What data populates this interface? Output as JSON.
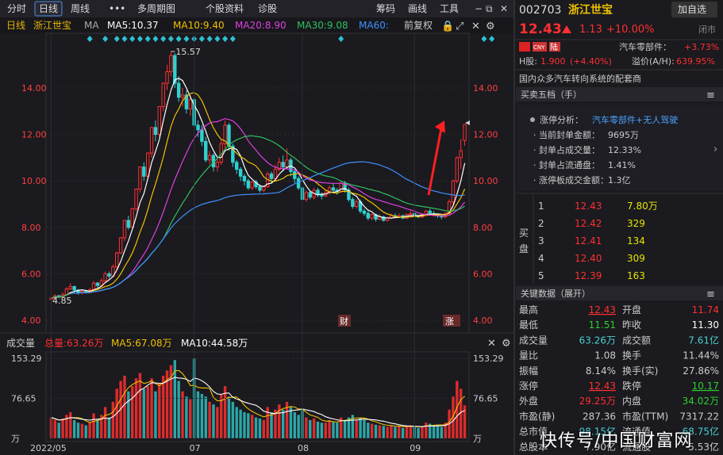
{
  "toolbar": {
    "tabs": [
      "分时",
      "日线",
      "周线",
      "•••",
      "多周期图",
      "个股资料",
      "诊股"
    ],
    "right": [
      "筹码",
      "画线",
      "工具"
    ],
    "colors": {
      "accent": "#4a90e2"
    }
  },
  "stock": {
    "code": "002703",
    "name": "浙江世宝",
    "add_label": "加自选",
    "price": "12.43",
    "change": "1.13",
    "pct": "+10.00%",
    "status": "闭市",
    "sector": "汽车零部件：",
    "sector_pct": "+3.73%",
    "h_label": "H股:",
    "h_price": "1.900",
    "h_pct": "(+4.40%)",
    "premium_label": "溢价(A/H):",
    "premium": "639.95%",
    "desc": "国内众多汽车转向系统的配套商",
    "cny": "CNY",
    "lu": "陆"
  },
  "chart_header": {
    "period": "日线",
    "name": "浙江世宝",
    "ma": "MA",
    "ma5": "MA5:10.37",
    "ma10": "MA10:9.40",
    "ma20": "MA20:8.90",
    "ma30": "MA30:9.08",
    "ma60": "MA60:",
    "fq": "前复权"
  },
  "vol_header": {
    "label": "成交量",
    "total": "总量:63.26万",
    "ma5": "MA5:67.08万",
    "ma10": "MA10:44.58万"
  },
  "markers": {
    "cai": "财",
    "zhang": "涨",
    "high": "15.57",
    "low": "4.85"
  },
  "order_book": {
    "title": "买卖五档（手）",
    "analysis_label": "涨停分析：",
    "analysis_value": "汽车零部件+无人驾驶",
    "lines": [
      {
        "label": "当前封单金额：",
        "value": "9695万"
      },
      {
        "label": "封单占成交量：",
        "value": "12.33%"
      },
      {
        "label": "封单占流通盘：",
        "value": "1.41%"
      },
      {
        "label": "涨停板成交金额：",
        "value": "1.3亿"
      }
    ],
    "buy_label_1": "买",
    "buy_label_2": "盘",
    "buys": [
      {
        "n": "1",
        "p": "12.43",
        "v": "7.80万"
      },
      {
        "n": "2",
        "p": "12.42",
        "v": "329"
      },
      {
        "n": "3",
        "p": "12.41",
        "v": "134"
      },
      {
        "n": "4",
        "p": "12.40",
        "v": "309"
      },
      {
        "n": "5",
        "p": "12.39",
        "v": "163"
      }
    ]
  },
  "key_data": {
    "title": "关键数据（展开）",
    "rows": [
      [
        "最高",
        "12.43",
        "开盘",
        "11.74"
      ],
      [
        "最低",
        "11.51",
        "昨收",
        "11.30"
      ],
      [
        "成交量",
        "63.26万",
        "成交额",
        "7.61亿"
      ],
      [
        "量比",
        "1.08",
        "换手",
        "11.44%"
      ],
      [
        "振幅",
        "8.14%",
        "换手(实)",
        "27.86%"
      ],
      [
        "涨停",
        "12.43",
        "跌停",
        "10.17"
      ],
      [
        "外盘",
        "29.25万",
        "内盘",
        "34.02万"
      ],
      [
        "市盈(静)",
        "287.36",
        "市盈(TTM)",
        "7317.22"
      ],
      [
        "总市值",
        "98.15亿",
        "流通值",
        "68.75亿"
      ],
      [
        "总股本",
        "7.90亿",
        "流通股",
        "5.53亿"
      ]
    ]
  },
  "watermark": "快传号/中国财富网",
  "chart_data": {
    "type": "candlestick",
    "ylim": [
      3.8,
      16.5
    ],
    "yticks": [
      4.0,
      6.0,
      8.0,
      10.0,
      12.0,
      14.0
    ],
    "xticks": [
      {
        "i": 0,
        "label": "2022/05"
      },
      {
        "i": 37,
        "label": "07"
      },
      {
        "i": 65,
        "label": "08"
      },
      {
        "i": 94,
        "label": "09"
      }
    ],
    "vol_ylim": [
      0,
      153.29
    ],
    "vol_ticks": [
      "153.29",
      "76.65",
      "万"
    ],
    "candles": [
      [
        4.9,
        4.95,
        5.05,
        4.85,
        40
      ],
      [
        4.95,
        5.05,
        5.12,
        4.9,
        35
      ],
      [
        5.05,
        5.0,
        5.1,
        4.95,
        30
      ],
      [
        5.0,
        5.1,
        5.2,
        4.98,
        38
      ],
      [
        5.1,
        5.35,
        5.42,
        5.05,
        45
      ],
      [
        5.35,
        5.45,
        5.6,
        5.3,
        50
      ],
      [
        5.45,
        5.3,
        5.5,
        5.2,
        35
      ],
      [
        5.3,
        5.2,
        5.35,
        5.1,
        30
      ],
      [
        5.2,
        5.25,
        5.3,
        5.1,
        28
      ],
      [
        5.25,
        5.2,
        5.3,
        5.15,
        25
      ],
      [
        5.2,
        5.3,
        5.4,
        5.15,
        32
      ],
      [
        5.3,
        5.6,
        5.7,
        5.25,
        48
      ],
      [
        5.6,
        5.5,
        5.65,
        5.4,
        36
      ],
      [
        5.5,
        5.7,
        5.8,
        5.45,
        45
      ],
      [
        5.7,
        6.0,
        6.1,
        5.65,
        60
      ],
      [
        6.0,
        5.9,
        6.1,
        5.8,
        40
      ],
      [
        5.9,
        6.3,
        6.4,
        5.85,
        70
      ],
      [
        6.3,
        6.9,
        6.95,
        6.2,
        95
      ],
      [
        6.9,
        7.55,
        7.58,
        6.85,
        110
      ],
      [
        7.55,
        8.3,
        8.3,
        7.4,
        120
      ],
      [
        8.3,
        8.0,
        8.5,
        7.9,
        90
      ],
      [
        8.0,
        8.8,
        8.85,
        7.95,
        100
      ],
      [
        8.8,
        9.65,
        9.68,
        8.7,
        115
      ],
      [
        9.65,
        10.6,
        10.62,
        9.5,
        125
      ],
      [
        10.6,
        10.2,
        10.8,
        10.0,
        95
      ],
      [
        10.2,
        11.2,
        11.22,
        10.1,
        100
      ],
      [
        11.2,
        12.3,
        12.32,
        11.0,
        115
      ],
      [
        12.3,
        12.0,
        12.6,
        11.7,
        90
      ],
      [
        12.0,
        13.2,
        13.22,
        11.9,
        105
      ],
      [
        13.2,
        14.2,
        14.25,
        13.0,
        120
      ],
      [
        14.2,
        14.7,
        15.0,
        13.9,
        130
      ],
      [
        14.7,
        15.4,
        15.57,
        14.5,
        140
      ],
      [
        15.4,
        14.2,
        15.5,
        14.0,
        150
      ],
      [
        14.2,
        13.6,
        14.5,
        13.4,
        110
      ],
      [
        13.6,
        13.7,
        14.0,
        13.2,
        90
      ],
      [
        13.7,
        13.1,
        13.9,
        12.9,
        80
      ],
      [
        13.1,
        13.5,
        13.7,
        12.8,
        75
      ],
      [
        13.5,
        12.4,
        13.6,
        12.3,
        153
      ],
      [
        12.4,
        12.2,
        12.6,
        11.9,
        90
      ],
      [
        12.2,
        11.7,
        12.4,
        11.5,
        85
      ],
      [
        11.7,
        10.9,
        11.9,
        10.8,
        80
      ],
      [
        10.9,
        11.1,
        11.3,
        10.7,
        70
      ],
      [
        11.1,
        10.6,
        11.2,
        10.4,
        65
      ],
      [
        10.6,
        10.8,
        11.0,
        10.4,
        60
      ],
      [
        10.8,
        11.6,
        11.8,
        10.7,
        85
      ],
      [
        11.6,
        12.4,
        12.6,
        11.4,
        100
      ],
      [
        12.4,
        11.5,
        12.5,
        11.3,
        80
      ],
      [
        11.5,
        10.8,
        11.6,
        10.6,
        70
      ],
      [
        10.8,
        10.5,
        10.9,
        10.3,
        60
      ],
      [
        10.5,
        10.2,
        10.6,
        10.0,
        55
      ],
      [
        10.2,
        10.0,
        10.3,
        9.8,
        50
      ],
      [
        10.0,
        9.7,
        10.1,
        9.6,
        48
      ],
      [
        9.7,
        9.95,
        10.0,
        9.6,
        45
      ],
      [
        9.95,
        9.75,
        10.05,
        9.65,
        40
      ],
      [
        9.75,
        9.6,
        9.85,
        9.5,
        38
      ],
      [
        9.6,
        9.75,
        9.8,
        9.5,
        35
      ],
      [
        9.75,
        10.3,
        10.4,
        9.7,
        60
      ],
      [
        10.3,
        10.1,
        10.4,
        9.9,
        50
      ],
      [
        10.1,
        10.5,
        10.7,
        10.0,
        55
      ],
      [
        10.5,
        10.8,
        11.0,
        10.4,
        65
      ],
      [
        10.8,
        10.6,
        11.1,
        10.4,
        55
      ],
      [
        10.6,
        10.9,
        11.4,
        10.5,
        70
      ],
      [
        10.9,
        10.4,
        11.0,
        10.2,
        60
      ],
      [
        10.4,
        10.1,
        10.5,
        9.9,
        50
      ],
      [
        10.1,
        9.7,
        10.2,
        9.6,
        45
      ],
      [
        9.7,
        9.2,
        9.8,
        9.1,
        55
      ],
      [
        9.2,
        9.5,
        9.6,
        9.1,
        40
      ],
      [
        9.5,
        9.3,
        9.6,
        9.2,
        35
      ],
      [
        9.3,
        9.6,
        9.7,
        9.2,
        38
      ],
      [
        9.6,
        9.4,
        9.7,
        9.3,
        32
      ],
      [
        9.4,
        9.35,
        9.5,
        9.2,
        30
      ],
      [
        9.35,
        9.5,
        9.6,
        9.3,
        30
      ],
      [
        9.5,
        9.7,
        9.8,
        9.4,
        35
      ],
      [
        9.7,
        9.6,
        9.9,
        9.5,
        32
      ],
      [
        9.6,
        9.55,
        9.7,
        9.4,
        30
      ],
      [
        9.55,
        9.9,
        10.0,
        9.5,
        40
      ],
      [
        9.9,
        9.6,
        10.0,
        9.5,
        35
      ],
      [
        9.6,
        9.2,
        9.7,
        9.1,
        40
      ],
      [
        9.2,
        8.9,
        9.3,
        8.8,
        45
      ],
      [
        8.9,
        9.1,
        9.2,
        8.8,
        35
      ],
      [
        9.1,
        8.7,
        9.2,
        8.6,
        40
      ],
      [
        8.7,
        8.6,
        8.8,
        8.5,
        35
      ],
      [
        8.6,
        8.4,
        8.7,
        8.3,
        30
      ],
      [
        8.4,
        8.55,
        8.6,
        8.3,
        28
      ],
      [
        8.55,
        8.35,
        8.6,
        8.25,
        26
      ],
      [
        8.35,
        8.45,
        8.55,
        8.3,
        25
      ],
      [
        8.45,
        8.3,
        8.5,
        8.25,
        24
      ],
      [
        8.3,
        8.4,
        8.45,
        8.25,
        22
      ],
      [
        8.4,
        8.5,
        8.55,
        8.35,
        25
      ],
      [
        8.5,
        8.45,
        8.6,
        8.4,
        22
      ],
      [
        8.45,
        8.5,
        8.6,
        8.4,
        24
      ],
      [
        8.5,
        8.4,
        8.55,
        8.35,
        20
      ],
      [
        8.4,
        8.55,
        8.6,
        8.35,
        23
      ],
      [
        8.55,
        8.6,
        8.7,
        8.5,
        25
      ],
      [
        8.6,
        8.5,
        8.65,
        8.45,
        22
      ],
      [
        8.5,
        8.45,
        8.55,
        8.4,
        20
      ],
      [
        8.45,
        8.55,
        8.6,
        8.4,
        22
      ],
      [
        8.55,
        8.7,
        8.75,
        8.5,
        30
      ],
      [
        8.7,
        8.6,
        8.8,
        8.55,
        28
      ],
      [
        8.6,
        8.55,
        8.7,
        8.5,
        25
      ],
      [
        8.55,
        8.5,
        8.6,
        8.4,
        24
      ],
      [
        8.5,
        8.45,
        8.55,
        8.35,
        22
      ],
      [
        8.45,
        8.6,
        8.65,
        8.4,
        30
      ],
      [
        8.6,
        9.1,
        9.2,
        8.55,
        55
      ],
      [
        9.1,
        10.0,
        10.05,
        8.95,
        80
      ],
      [
        10.0,
        11.0,
        11.05,
        9.9,
        110
      ],
      [
        11.0,
        11.3,
        11.8,
        10.5,
        95
      ],
      [
        11.74,
        12.43,
        12.43,
        11.51,
        63.26
      ]
    ]
  }
}
